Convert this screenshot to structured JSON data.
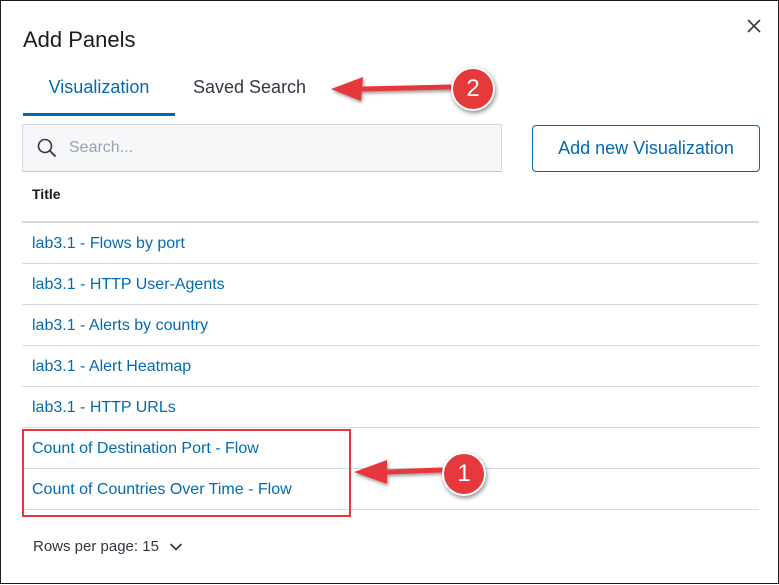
{
  "flyout": {
    "title": "Add Panels",
    "close_icon": "close-icon"
  },
  "tabs": [
    {
      "label": "Visualization",
      "selected": true
    },
    {
      "label": "Saved Search",
      "selected": false
    }
  ],
  "search": {
    "placeholder": "Search...",
    "value": "",
    "icon": "search-icon"
  },
  "add_button": {
    "label": "Add new Visualization"
  },
  "table": {
    "column_title": "Title",
    "rows": [
      "lab3.1 - Flows by port",
      "lab3.1 - HTTP User-Agents",
      "lab3.1 - Alerts by country",
      "lab3.1 - Alert Heatmap",
      "lab3.1 - HTTP URLs",
      "Count of Destination Port - Flow",
      "Count of Countries Over Time - Flow"
    ]
  },
  "pagination": {
    "label": "Rows per page: 15",
    "icon": "chevron-down-icon"
  },
  "annotations": {
    "badge_1": "1",
    "badge_2": "2",
    "accent_color": "#e5393c"
  },
  "colors": {
    "link": "#006bb4",
    "text": "#1a1c21",
    "border": "#d3dae6"
  }
}
